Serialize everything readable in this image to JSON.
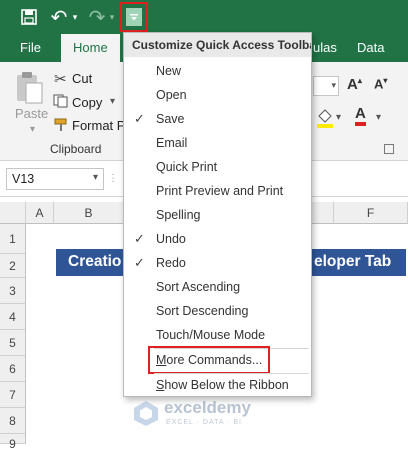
{
  "qat": {
    "undo_glyph": "↶",
    "redo_glyph": "↷"
  },
  "tabs": [
    "File",
    "Home",
    "ulas",
    "Data"
  ],
  "ribbon": {
    "paste_label": "Paste",
    "cut_label": "Cut",
    "copy_label": "Copy",
    "format_painter_label": "Format Pa",
    "clipboard_group": "Clipboard",
    "font_letter": "A"
  },
  "name_box": {
    "value": "V13"
  },
  "columns": [
    "A",
    "B",
    "F"
  ],
  "rows": [
    "1",
    "2",
    "3",
    "4",
    "5",
    "6",
    "7",
    "8",
    "9"
  ],
  "banner": {
    "left_text": "Creatio",
    "right_text": "eloper Tab",
    "color": "#2f5597"
  },
  "menu": {
    "title": "Customize Quick Access Toolbar",
    "items": [
      {
        "label": "New",
        "checked": false
      },
      {
        "label": "Open",
        "checked": false
      },
      {
        "label": "Save",
        "checked": true
      },
      {
        "label": "Email",
        "checked": false
      },
      {
        "label": "Quick Print",
        "checked": false
      },
      {
        "label": "Print Preview and Print",
        "checked": false
      },
      {
        "label": "Spelling",
        "checked": false
      },
      {
        "label": "Undo",
        "checked": true
      },
      {
        "label": "Redo",
        "checked": true
      },
      {
        "label": "Sort Ascending",
        "checked": false
      },
      {
        "label": "Sort Descending",
        "checked": false
      },
      {
        "label": "Touch/Mouse Mode",
        "checked": false
      },
      {
        "label": "More Commands...",
        "checked": false
      },
      {
        "label": "Show Below the Ribbon",
        "checked": false
      }
    ],
    "checkmark": "✓"
  },
  "watermark": {
    "brand": "exceldemy",
    "tagline": "EXCEL · DATA · BI"
  },
  "colors": {
    "excel_green": "#217346",
    "highlight_red": "#e02020"
  }
}
